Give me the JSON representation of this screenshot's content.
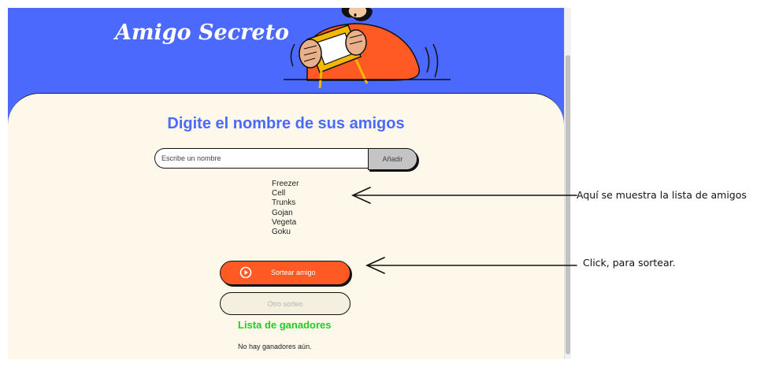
{
  "header": {
    "title": "Amigo Secreto"
  },
  "main": {
    "heading": "Digite el nombre de sus amigos",
    "input": {
      "placeholder": "Escribe un nombre",
      "value": ""
    },
    "add_button": "Añadir",
    "friends": [
      "Freezer",
      "Cell",
      "Trunks",
      "Gojan",
      "Vegeta",
      "Goku"
    ],
    "draw_button": "Sortear amigo",
    "again_button": "Otro sorteo",
    "winners_title": "Lista de ganadores",
    "winners_empty": "No hay ganadores aún."
  },
  "annotations": {
    "list": "Aquí se muestra la lista de amigos",
    "draw": "Click, para sortear."
  },
  "colors": {
    "brand_blue": "#4b69fd",
    "accent_orange": "#ff5a24",
    "card_bg": "#fdf8ea",
    "winners_green": "#22cc22"
  },
  "icons": [
    "play-icon"
  ]
}
